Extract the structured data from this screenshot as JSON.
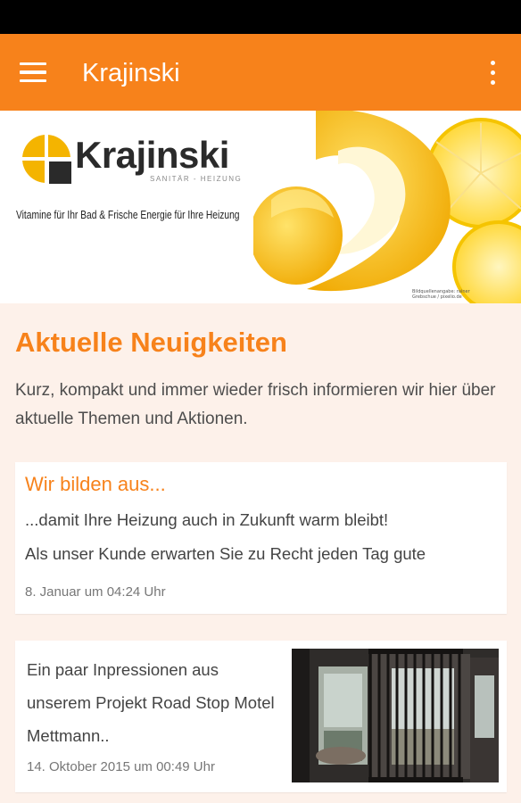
{
  "app_bar": {
    "title": "Krajinski",
    "menu_icon": "hamburger-menu-icon",
    "overflow_icon": "more-vertical-icon",
    "color": "#f7821b"
  },
  "banner": {
    "logo_name": "Krajinski",
    "logo_subtitle": "SANITÄR - HEIZUNG",
    "tagline": "Vitamine für Ihr Bad & Frische Energie für Ihre Heizung",
    "photo_credit": "Bildquellenangabe: rainer Grebschue / pixelio.de"
  },
  "section": {
    "title": "Aktuelle Neuigkeiten",
    "intro": "Kurz, kompakt und immer wieder frisch informieren wir hier über aktuelle Themen und Aktionen."
  },
  "posts": [
    {
      "title": "Wir bilden aus...",
      "line1": "...damit Ihre Heizung auch in Zukunft warm bleibt!",
      "line2": "Als unser Kunde erwarten Sie zu Recht jeden Tag gute",
      "date": "8. Januar um 04:24 Uhr"
    },
    {
      "text": "Ein paar Inpressionen aus unserem Projekt Road Stop Motel Mettmann..",
      "date": "14. Oktober 2015 um 00:49 Uhr",
      "thumbnail": "motel-room-photo"
    }
  ]
}
